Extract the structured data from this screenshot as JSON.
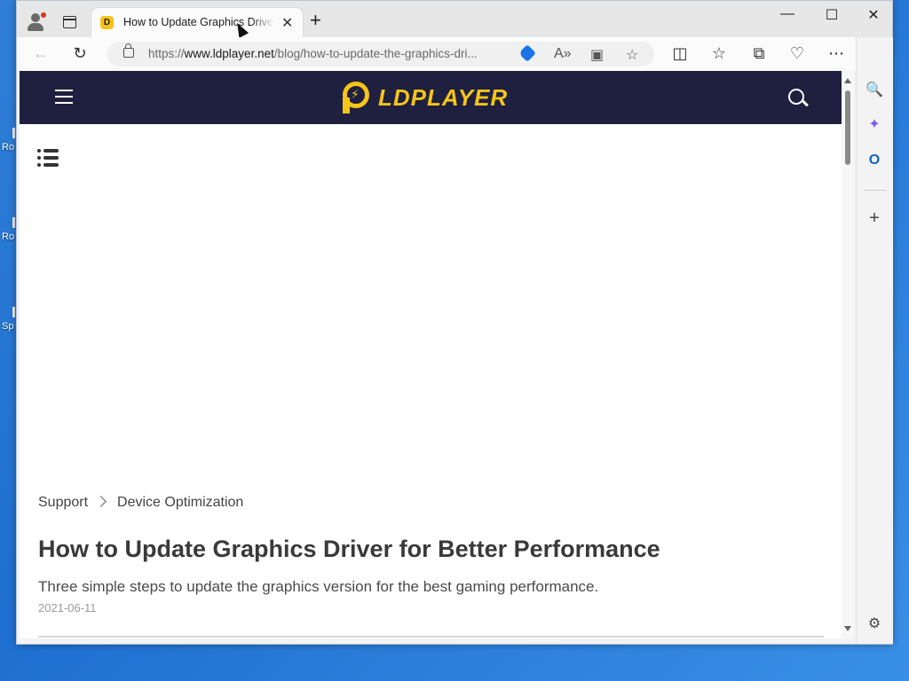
{
  "desktop": {
    "icon_labels": [
      "Ro",
      "Ro",
      "Sp"
    ]
  },
  "tab": {
    "title": "How to Update Graphics Driver for Better Performance",
    "favicon": "ldplayer-favicon",
    "close_icon": "close-icon"
  },
  "window_controls": {
    "minimize": "—",
    "maximize": "☐",
    "close": "✕"
  },
  "address_bar": {
    "prefix": "https://",
    "host": "www.ldplayer.net",
    "path": "/blog/how-to-update-the-graphics-dri..."
  },
  "toolbar_icons": [
    "back-icon",
    "refresh-icon",
    "lock-icon",
    "coupon-tag-icon",
    "read-aloud-icon",
    "immersive-reader-icon",
    "favorite-star-icon",
    "split-screen-icon",
    "favorites-icon",
    "collections-icon",
    "browser-essentials-icon",
    "more-icon",
    "copilot-icon"
  ],
  "site": {
    "logo_text": "LDPLAYER",
    "brand_color": "#f5c518",
    "header_color": "#1f1f3f"
  },
  "breadcrumb": [
    "Support",
    "Device Optimization"
  ],
  "article": {
    "title": "How to Update Graphics Driver for Better Performance",
    "subtitle": "Three simple steps to update the graphics version for the best gaming performance.",
    "date": "2021-06-11"
  },
  "sidebar_icons": [
    "search-icon",
    "copilot-apps-icon",
    "outlook-icon",
    "add-icon",
    "settings-icon"
  ]
}
